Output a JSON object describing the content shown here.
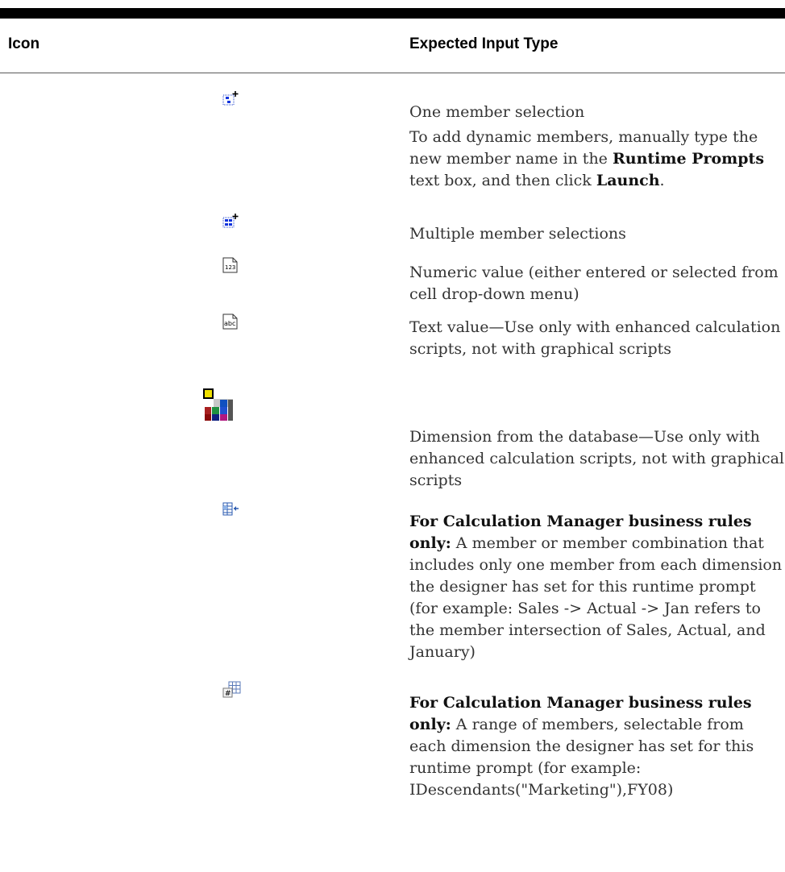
{
  "table": {
    "headers": {
      "icon": "Icon",
      "input_type": "Expected Input Type"
    },
    "rows": [
      {
        "icon": "single-member-icon",
        "p1": "One member selection",
        "p2_a": "To add dynamic members, manually type the new member name in the ",
        "p2_b": "Runtime Prompts",
        "p2_c": " text box, and then click ",
        "p2_d": "Launch",
        "p2_e": "."
      },
      {
        "icon": "multiple-members-icon",
        "text": "Multiple member selections"
      },
      {
        "icon": "numeric-value-icon",
        "text": "Numeric value (either entered or selected from cell drop-down menu)"
      },
      {
        "icon": "text-value-icon",
        "text": "Text value—Use only with enhanced calculation scripts, not with graphical scripts"
      },
      {
        "icon": "dimension-icon",
        "text": "Dimension from the database—Use only with enhanced calculation scripts, not with graphical scripts"
      },
      {
        "icon": "cross-dimension-icon",
        "bold": "For Calculation Manager business rules only:",
        "text": " A member or member combination that includes only one member from each dimension the designer has set for this runtime prompt (for example: Sales -> Actual -> Jan refers to the member intersection of Sales, Actual, and January)"
      },
      {
        "icon": "member-range-icon",
        "bold": "For Calculation Manager business rules only:",
        "text": " A range of members, selectable from each dimension the designer has set for this runtime prompt (for example: IDescendants(\"Marketing\"),FY08)"
      }
    ]
  },
  "icon_glyphs": {
    "numeric": "123",
    "text": "abc",
    "hash": "#"
  }
}
